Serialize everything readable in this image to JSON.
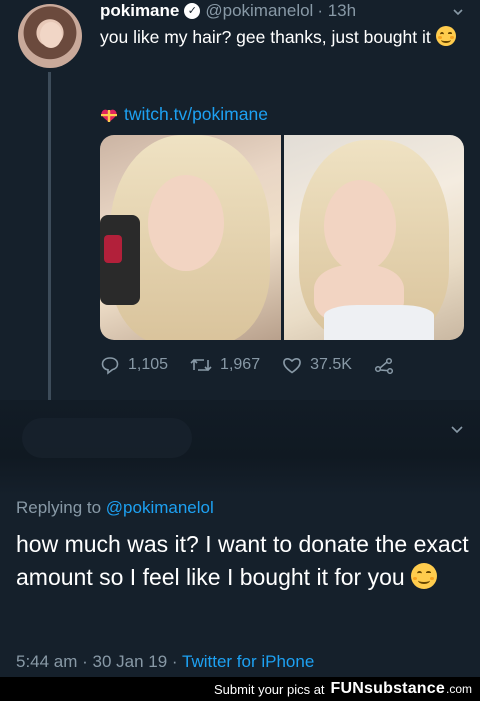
{
  "tweet": {
    "name": "pokimane",
    "handle": "@pokimanelol",
    "time": "· 13h",
    "text_line": "you like my hair? gee thanks, just bought it",
    "link": "twitch.tv/pokimane",
    "counts": {
      "replies": "1,105",
      "retweets": "1,967",
      "likes": "37.5K"
    }
  },
  "reply": {
    "replying_prefix": "Replying to",
    "replying_handle": "@pokimanelol",
    "text": "how much was it? I want to donate the exact amount so I feel like I bought it for you",
    "meta_time": "5:44 am · 30 Jan 19 ·",
    "meta_source": "Twitter for iPhone"
  },
  "footer": {
    "prefix": "Submit your pics at",
    "brand": "FUNsubstance",
    "suffix": ".com"
  },
  "colors": {
    "background": "#15202b",
    "link": "#1da1f2",
    "muted": "#8899a6"
  },
  "icons": [
    "verified-badge-icon",
    "chevron-down-icon",
    "gift-heart-icon",
    "reply-icon",
    "retweet-icon",
    "like-icon",
    "share-icon",
    "smiling-face-emoji"
  ]
}
